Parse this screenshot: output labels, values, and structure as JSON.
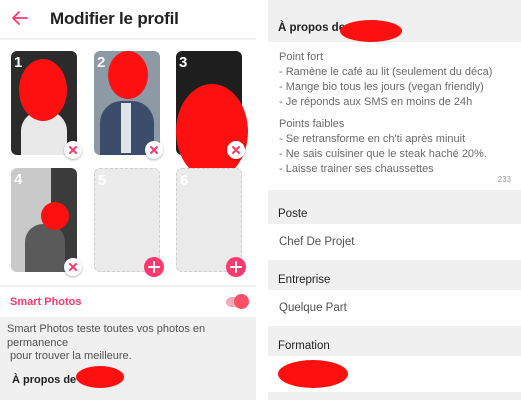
{
  "left": {
    "header": {
      "title": "Modifier le profil"
    },
    "photos": [
      {
        "index": "1",
        "state": "filled"
      },
      {
        "index": "2",
        "state": "filled"
      },
      {
        "index": "3",
        "state": "filled"
      },
      {
        "index": "4",
        "state": "filled"
      },
      {
        "index": "5",
        "state": "empty"
      },
      {
        "index": "6",
        "state": "empty"
      }
    ],
    "smart_photos": {
      "label": "Smart Photos",
      "enabled": true,
      "description_line1": "Smart Photos teste toutes vos photos en",
      "description_line2": "permanence",
      "description_line3": " pour trouver la meilleure."
    },
    "about_label": "À propos de"
  },
  "right": {
    "about_label": "À propos de",
    "bio": {
      "line1": "Point fort",
      "line2": "- Ramène le café au lit (seulement du déca)",
      "line3": "- Mange bio tous les jours (vegan friendly)",
      "line4": "- Je réponds aux SMS en moins de 24h",
      "line5": "Points faibles",
      "line6": "- Se retransforme en ch'ti après minuit",
      "line7": "- Ne sais cuisiner que le steak haché 20%.",
      "line8": "- Laisse trainer ses chaussettes",
      "counter": "233"
    },
    "poste": {
      "label": "Poste",
      "value": "Chef De Projet"
    },
    "entreprise": {
      "label": "Entreprise",
      "value": "Quelque Part"
    },
    "formation": {
      "label": "Formation"
    }
  },
  "colors": {
    "accent": "#fd3a6e",
    "redaction": "#ff1010",
    "background": "#f0f0f0"
  },
  "icons": {
    "back": "arrow-left-icon",
    "remove": "close-icon",
    "add": "plus-icon"
  }
}
